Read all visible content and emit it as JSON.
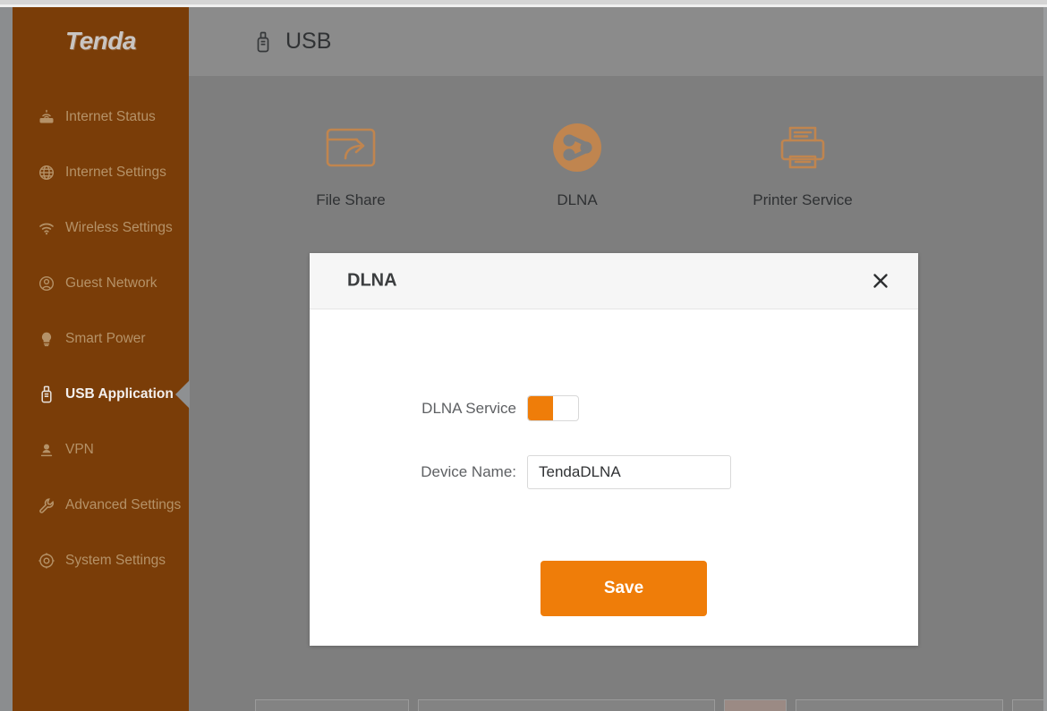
{
  "brand": {
    "name": "Tenda"
  },
  "colors": {
    "sidebar_bg": "#7A3D08",
    "accent_orange": "#EF7D09",
    "icon_orange": "#C0854F",
    "overlay_gray": "#7E7E7E",
    "header_gray": "#8B8B8B",
    "modal_header_bg": "#F6F6F6"
  },
  "sidebar": {
    "items": [
      {
        "label": "Internet Status",
        "icon": "router-icon",
        "active": false
      },
      {
        "label": "Internet Settings",
        "icon": "globe-icon",
        "active": false
      },
      {
        "label": "Wireless Settings",
        "icon": "wifi-icon",
        "active": false
      },
      {
        "label": "Guest Network",
        "icon": "guest-icon",
        "active": false
      },
      {
        "label": "Smart Power",
        "icon": "bulb-icon",
        "active": false
      },
      {
        "label": "USB Application",
        "icon": "usb-icon",
        "active": true
      },
      {
        "label": "VPN",
        "icon": "vpn-lock-icon",
        "active": false
      },
      {
        "label": "Advanced Settings",
        "icon": "wrench-icon",
        "active": false
      },
      {
        "label": "System Settings",
        "icon": "gear-icon",
        "active": false
      }
    ]
  },
  "header": {
    "icon": "usb-icon",
    "title": "USB"
  },
  "services": [
    {
      "label": "File Share",
      "icon": "file-share-icon"
    },
    {
      "label": "DLNA",
      "icon": "dlna-icon"
    },
    {
      "label": "Printer Service",
      "icon": "printer-icon"
    }
  ],
  "modal": {
    "title": "DLNA",
    "close_icon": "close-icon",
    "fields": {
      "service": {
        "label": "DLNA Service",
        "toggle_state": "on"
      },
      "device_name": {
        "label": "Device Name:",
        "value": "TendaDLNA",
        "placeholder": "TendaDLNA"
      }
    },
    "save_label": "Save"
  }
}
